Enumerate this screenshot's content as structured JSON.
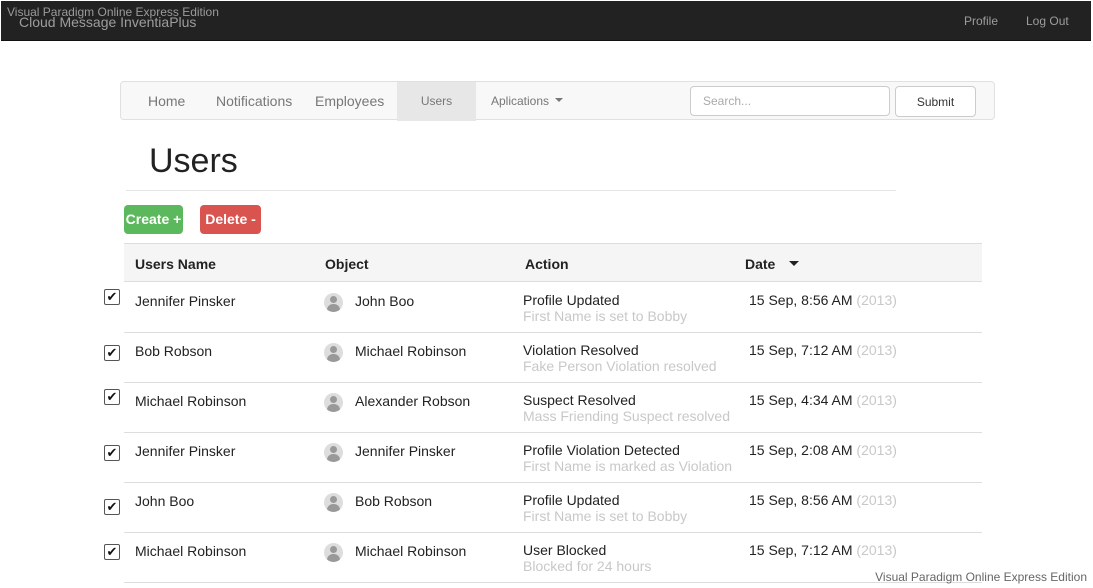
{
  "watermark": "Visual Paradigm Online Express Edition",
  "header": {
    "app_title": "Cloud Message InventiaPlus",
    "profile_label": "Profile",
    "logout_label": "Log Out"
  },
  "nav": {
    "home": "Home",
    "notifications": "Notifications",
    "employees": "Employees",
    "users": "Users",
    "applications": "Aplications",
    "search_placeholder": "Search...",
    "submit_label": "Submit"
  },
  "page": {
    "title": "Users",
    "create_label": "Create +",
    "delete_label": "Delete -"
  },
  "table": {
    "columns": [
      "Users Name",
      "Object",
      "Action",
      "Date"
    ],
    "rows": [
      {
        "checked": true,
        "user": "Jennifer Pinsker",
        "object": "John Boo",
        "action": "Profile Updated",
        "detail": "First Name is set to Bobby",
        "date": "15 Sep, 8:56 AM",
        "year": "(2013)"
      },
      {
        "checked": true,
        "user": "Bob Robson",
        "object": "Michael Robinson",
        "action": "Violation Resolved",
        "detail": "Fake Person Violation resolved",
        "date": "15 Sep, 7:12 AM",
        "year": "(2013)"
      },
      {
        "checked": true,
        "user": "Michael Robinson",
        "object": "Alexander Robson",
        "action": "Suspect Resolved",
        "detail": "Mass Friending Suspect resolved",
        "date": "15 Sep, 4:34 AM",
        "year": "(2013)"
      },
      {
        "checked": true,
        "user": "Jennifer Pinsker",
        "object": "Jennifer Pinsker",
        "action": "Profile Violation Detected",
        "detail": "First Name is marked as Violation",
        "date": "15 Sep, 2:08 AM",
        "year": "(2013)"
      },
      {
        "checked": true,
        "user": "John Boo",
        "object": "Bob Robson",
        "action": "Profile Updated",
        "detail": "First Name is set to Bobby",
        "date": "15 Sep, 8:56 AM",
        "year": "(2013)"
      },
      {
        "checked": true,
        "user": "Michael Robinson",
        "object": "Michael Robinson",
        "action": "User Blocked",
        "detail": "Blocked for 24 hours",
        "date": "15 Sep, 7:12 AM",
        "year": "(2013)"
      }
    ]
  },
  "icons": {
    "checkbox": "check-icon",
    "avatar": "user-avatar-icon",
    "dropdown": "caret-down-icon",
    "sort": "sort-desc-icon"
  }
}
